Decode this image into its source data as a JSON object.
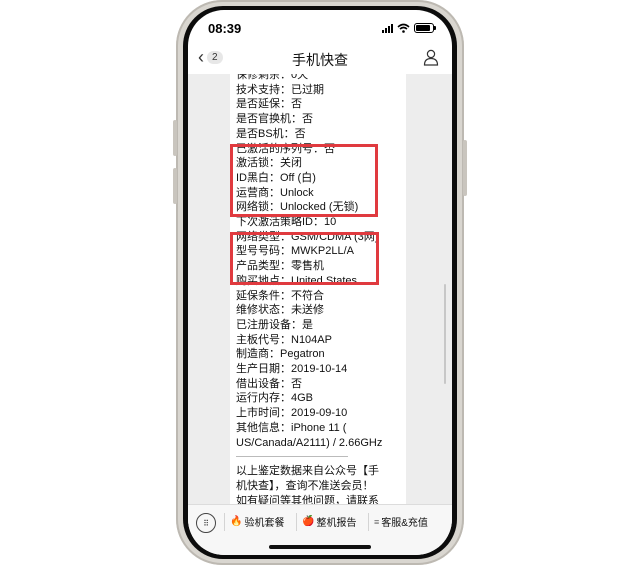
{
  "status_bar": {
    "time": "08:39"
  },
  "nav": {
    "back_count": "2",
    "title": "手机快查"
  },
  "message": {
    "lines": [
      "保修剩余：0天",
      "技术支持：已过期",
      "是否延保：否",
      "是否官换机：否",
      "是否BS机：否",
      "已激活的序列号：否",
      "激活锁：关闭",
      "ID黑白：Off (白)",
      "运营商：Unlock",
      "网络锁：Unlocked (无锁)",
      "下次激活策略ID：10",
      "网络类型：GSM/CDMA (3网)",
      "型号号码：MWKP2LL/A",
      "产品类型：零售机",
      "购买地点：United States",
      "延保条件：不符合",
      "维修状态：未送修",
      "已注册设备：是",
      "主板代号：N104AP",
      "制造商：Pegatron",
      "生产日期：2019-10-14",
      "借出设备：否",
      "运行内存：4GB",
      "上市时间：2019-09-10",
      "其他信息：iPhone 11 (",
      "US/Canada/A2111) / 2.66GHz"
    ],
    "footer_lines": [
      "以上鉴定数据来自公众号【手",
      "机快查】，查询不准送会员！",
      "如有疑问等其他问题，请联系"
    ],
    "highlight_color": "#e03a3f"
  },
  "menu": {
    "items": [
      {
        "emoji": "🔥",
        "label": "验机套餐"
      },
      {
        "emoji": "🍎",
        "label": "整机报告"
      },
      {
        "emoji": "",
        "label": "客服&充值"
      }
    ]
  }
}
